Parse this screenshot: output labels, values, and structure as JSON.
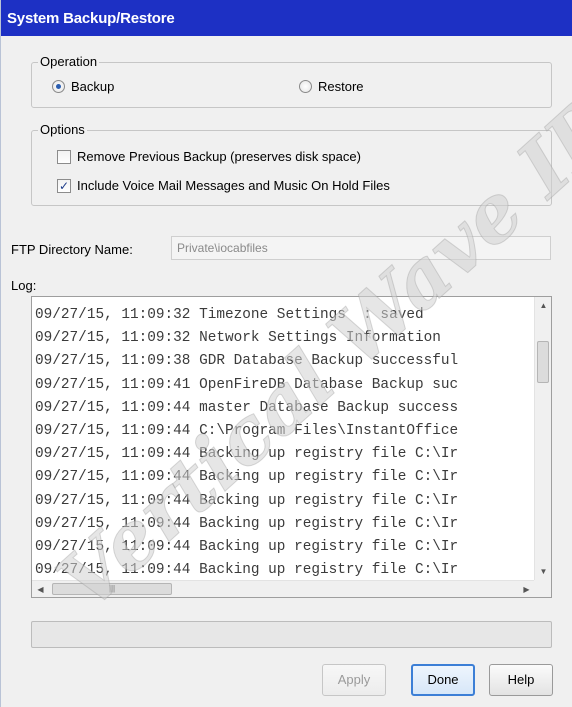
{
  "window": {
    "title": "System Backup/Restore"
  },
  "operation": {
    "legend": "Operation",
    "options": [
      {
        "label": "Backup",
        "selected": true
      },
      {
        "label": "Restore",
        "selected": false
      }
    ]
  },
  "options_group": {
    "legend": "Options",
    "items": [
      {
        "label": "Remove Previous Backup (preserves disk space)",
        "checked": false
      },
      {
        "label": "Include Voice Mail Messages and Music On Hold Files",
        "checked": true
      }
    ]
  },
  "ftp": {
    "label": "FTP Directory Name:",
    "value": "Private\\iocabfiles"
  },
  "log": {
    "label": "Log:",
    "lines": [
      "09/27/15, 11:09:32 Timezone Settings  : saved",
      "09/27/15, 11:09:32 Network Settings Information",
      "09/27/15, 11:09:38 GDR Database Backup successful",
      "09/27/15, 11:09:41 OpenFireDB Database Backup suc",
      "09/27/15, 11:09:44 master Database Backup success",
      "09/27/15, 11:09:44 C:\\Program Files\\InstantOffice",
      "09/27/15, 11:09:44 Backing up registry file C:\\Ir",
      "09/27/15, 11:09:44 Backing up registry file C:\\Ir",
      "09/27/15, 11:09:44 Backing up registry file C:\\Ir",
      "09/27/15, 11:09:44 Backing up registry file C:\\Ir",
      "09/27/15, 11:09:44 Backing up registry file C:\\Ir",
      "09/27/15, 11:09:44 Backing up registry file C:\\Ir"
    ]
  },
  "progress": {
    "value": 0
  },
  "buttons": {
    "apply": "Apply",
    "done": "Done",
    "help": "Help"
  },
  "watermark": {
    "text": "Vertical Wave IP Kno"
  },
  "colors": {
    "titlebar": "#1d30c4",
    "default_button_border": "#3c7fd6"
  }
}
